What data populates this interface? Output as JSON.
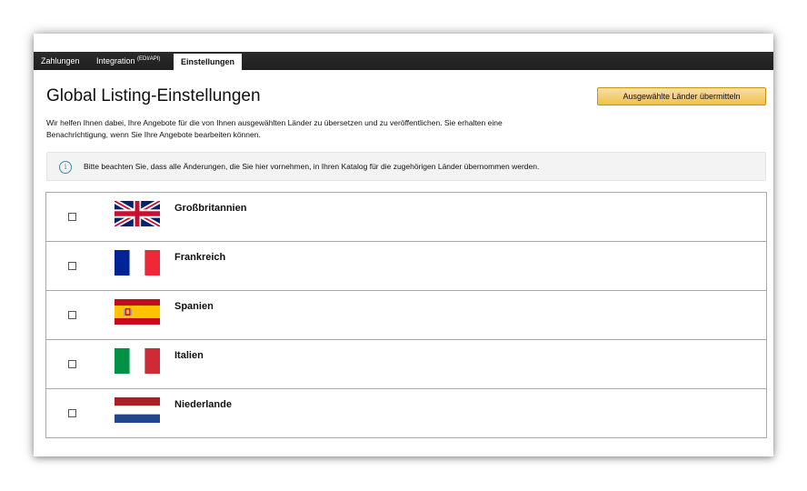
{
  "tabs": [
    {
      "label": "Zahlungen",
      "sup": ""
    },
    {
      "label": "Integration ",
      "sup": "(EDI/API)"
    },
    {
      "label": "Einstellungen",
      "sup": ""
    }
  ],
  "page": {
    "title": "Global Listing-Einstellungen",
    "submit_label": "Ausgewählte Länder übermitteln",
    "description": "Wir helfen Ihnen dabei, Ihre Angebote für die von Ihnen ausgewählten Länder zu übersetzen und zu veröffentlichen. Sie erhalten eine Benachrichtigung, wenn Sie Ihre Angebote bearbeiten können.",
    "notice": "Bitte beachten Sie, dass alle Änderungen, die Sie hier vornehmen, in Ihren Katalog für die zugehörigen Länder übernommen werden.",
    "info_icon": "i"
  },
  "countries": [
    {
      "name": "Großbritannien",
      "flag": "uk-flag-icon",
      "checked": false
    },
    {
      "name": "Frankreich",
      "flag": "france-flag-icon",
      "checked": false
    },
    {
      "name": "Spanien",
      "flag": "spain-flag-icon",
      "checked": false
    },
    {
      "name": "Italien",
      "flag": "italy-flag-icon",
      "checked": false
    },
    {
      "name": "Niederlande",
      "flag": "netherlands-flag-icon",
      "checked": false
    }
  ],
  "colors": {
    "tabbar": "#232323",
    "button": "#f0c14b",
    "info": "#3d8ea0"
  }
}
